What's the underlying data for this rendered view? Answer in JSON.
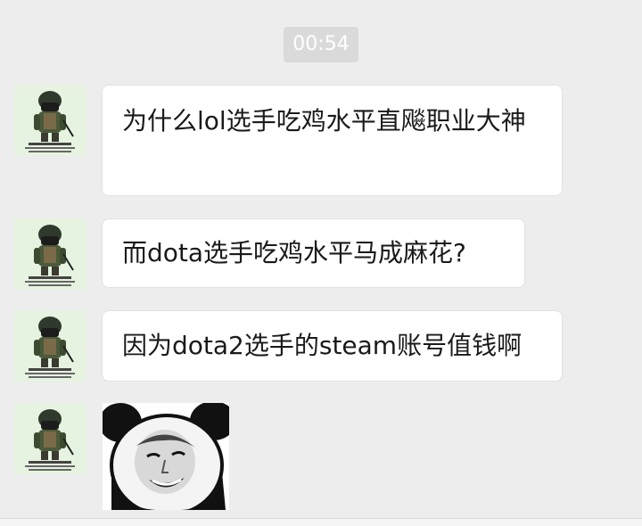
{
  "timestamp": "00:54",
  "messages": [
    {
      "text": "为什么lol选手吃鸡水平直飚职业大神",
      "avatar_icon": "soldier-avatar-icon"
    },
    {
      "text": "而dota选手吃鸡水平马成麻花?",
      "avatar_icon": "soldier-avatar-icon"
    },
    {
      "text": "因为dota2选手的steam账号值钱啊",
      "avatar_icon": "soldier-avatar-icon"
    },
    {
      "sticker": "panda-face-meme",
      "avatar_icon": "soldier-avatar-icon"
    }
  ],
  "colors": {
    "background": "#ededed",
    "bubble": "#ffffff",
    "timestamp_bg": "#dadada",
    "avatar_bg": "#e6f3e0"
  }
}
